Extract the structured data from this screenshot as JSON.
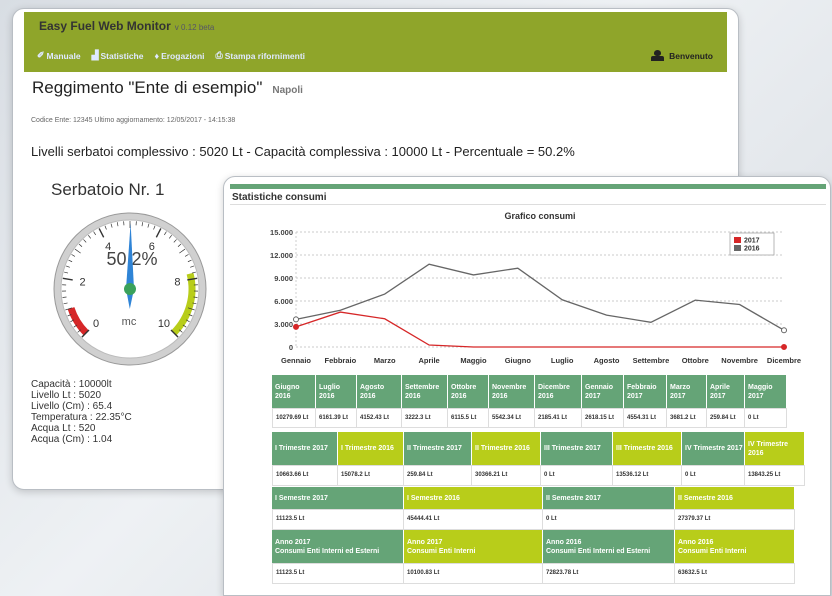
{
  "header": {
    "brand": "Easy Fuel Web Monitor",
    "version": "v 0.12 beta",
    "nav": [
      {
        "icon": "book-icon",
        "glyph": "✐",
        "label": "Manuale"
      },
      {
        "icon": "bar-chart-icon",
        "glyph": "▟",
        "label": "Statistiche"
      },
      {
        "icon": "fuel-drop-icon",
        "glyph": "♦",
        "label": "Erogazioni"
      },
      {
        "icon": "printer-icon",
        "glyph": "⎙",
        "label": "Stampa rifornimenti"
      }
    ],
    "welcome": "Benvenuto"
  },
  "page": {
    "title": "Reggimento \"Ente di esempio\"",
    "city": "Napoli",
    "codice": "Codice Ente: 12345 Ultimo aggiornamento: 12/05/2017 - 14:15:38",
    "livelli": "Livelli serbatoi complessivo  : 5020 Lt - Capacità complessiva  : 10000 Lt - Percentuale = 50.2%"
  },
  "tank": {
    "title": "Serbatoio Nr. 1",
    "percent_label": "50.2%",
    "unit": "mc",
    "level_fraction": 0.502,
    "scale_min": 0,
    "scale_max": 10,
    "major_ticks": [
      "0",
      "2",
      "4",
      "6",
      "8",
      "10"
    ],
    "info": [
      "Capacità : 10000lt",
      "Livello Lt : 5020",
      "Livello (Cm) : 65.4",
      "Temperatura : 22.35°C",
      "Acqua Lt : 520",
      "Acqua (Cm) : 1.04"
    ],
    "colors": {
      "red_zone": "#d62728",
      "green_zone": "#b8cd1a",
      "needle": "#2f84d6",
      "hub": "#3aa15a"
    }
  },
  "stats": {
    "heading": "Statistiche consumi",
    "monthly": {
      "headers": [
        "Giugno 2016",
        "Luglio 2016",
        "Agosto 2016",
        "Settembre 2016",
        "Ottobre 2016",
        "Novembre 2016",
        "Dicembre 2016",
        "Gennaio 2017",
        "Febbraio 2017",
        "Marzo 2017",
        "Aprile 2017",
        "Maggio 2017"
      ],
      "values": [
        "10279.69 Lt",
        "6161.39 Lt",
        "4152.43 Lt",
        "3222.3 Lt",
        "6115.5 Lt",
        "5542.34 Lt",
        "2185.41 Lt",
        "2618.15 Lt",
        "4554.31 Lt",
        "3681.2 Lt",
        "259.84 Lt",
        "0 Lt"
      ]
    },
    "quarters": {
      "headers": [
        "I Trimestre 2017",
        "I Trimestre 2016",
        "II Trimestre 2017",
        "II Trimestre 2016",
        "III Trimestre 2017",
        "III Trimestre 2016",
        "IV Trimestre 2017",
        "IV Trimestre 2016"
      ],
      "values": [
        "10663.66 Lt",
        "15078.2 Lt",
        "259.84 Lt",
        "30366.21 Lt",
        "0 Lt",
        "13536.12 Lt",
        "0 Lt",
        "13843.25 Lt"
      ]
    },
    "semesters": {
      "headers": [
        "I Semestre 2017",
        "I Semestre 2016",
        "II Semestre 2017",
        "II Semestre 2016"
      ],
      "values": [
        "11123.5 Lt",
        "45444.41 Lt",
        "0 Lt",
        "27379.37 Lt"
      ]
    },
    "years": {
      "headers": [
        "Anno 2017\nConsumi Enti Interni ed Esterni",
        "Anno 2017\nConsumi Enti Interni",
        "Anno 2016\nConsumi Enti Interni ed Esterni",
        "Anno 2016\nConsumi Enti Interni"
      ],
      "values": [
        "11123.5 Lt",
        "10100.83 Lt",
        "72823.78 Lt",
        "63632.5 Lt"
      ]
    }
  },
  "chart_data": {
    "type": "line",
    "title": "Grafico consumi",
    "categories": [
      "Gennaio",
      "Febbraio",
      "Marzo",
      "Aprile",
      "Maggio",
      "Giugno",
      "Luglio",
      "Agosto",
      "Settembre",
      "Ottobre",
      "Novembre",
      "Dicembre"
    ],
    "ylim": [
      0,
      15000
    ],
    "yticks": [
      "0",
      "3.000",
      "6.000",
      "9.000",
      "12.000",
      "15.000"
    ],
    "grid": true,
    "legend_position": "top-right",
    "series": [
      {
        "name": "2017",
        "color": "#d62728",
        "values": [
          2618.15,
          4554.31,
          3681.2,
          259.84,
          0,
          0,
          0,
          0,
          0,
          0,
          0,
          0
        ]
      },
      {
        "name": "2016",
        "color": "#666666",
        "values": [
          3600,
          4800,
          6900,
          10800,
          9400,
          10279.69,
          6161.39,
          4152.43,
          3222.3,
          6115.5,
          5542.34,
          2185.41
        ]
      }
    ]
  }
}
